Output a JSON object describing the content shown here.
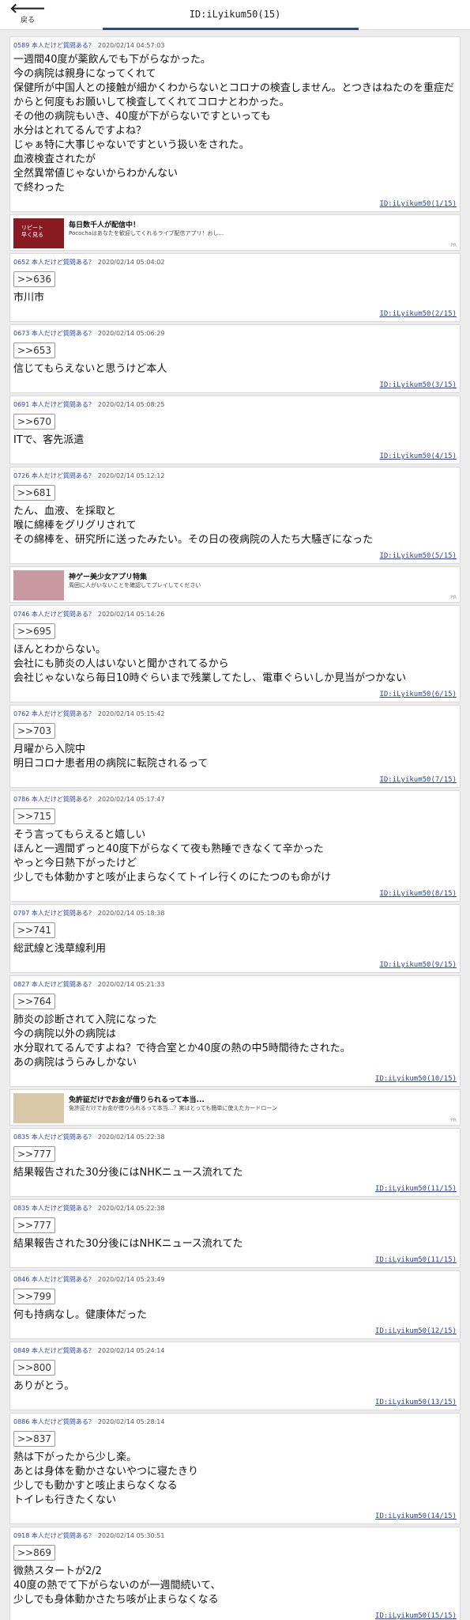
{
  "header": {
    "back_arrow": "🡐",
    "back_label": "戻る",
    "title": "ID:iLyikum50(15)"
  },
  "posts": [
    {
      "meta": "0589 本人だけど質問ある？",
      "ts": "2020/02/14 04:57:03",
      "anchor": "",
      "body": "一週間40度が薬飲んでも下がらなかった。\n今の病院は親身になってくれて\n保健所が中国人との接触が細かくわからないとコロナの検査しません。とつきはねたのを重症だからと何度もお願いして検査してくれてコロナとわかった。\nその他の病院もいき、40度が下がらないですといっても\n水分はとれてるんですよね？\nじゃぁ特に大事じゃないですという扱いをされた。\n血液検査されたが\n全然異常値じゃないからわかんない\nで終わった",
      "uid": "ID:iLyikum50(1/15)"
    },
    {
      "meta": "0652 本人だけど質問ある？",
      "ts": "2020/02/14 05:04:02",
      "anchor": ">>636",
      "body": "市川市",
      "uid": "ID:iLyikum50(2/15)"
    },
    {
      "meta": "0673 本人だけど質問ある？",
      "ts": "2020/02/14 05:06:29",
      "anchor": ">>653",
      "body": "信じてもらえないと思うけど本人",
      "uid": "ID:iLyikum50(3/15)"
    },
    {
      "meta": "0691 本人だけど質問ある？",
      "ts": "2020/02/14 05:08:25",
      "anchor": ">>670",
      "body": "ITで、客先派遣",
      "uid": "ID:iLyikum50(4/15)"
    },
    {
      "meta": "0726 本人だけど質問ある？",
      "ts": "2020/02/14 05:12:12",
      "anchor": ">>681",
      "body": "たん、血液、を採取と\n喉に綿棒をグリグリされて\nその綿棒を、研究所に送ったみたい。その日の夜病院の人たち大騒ぎになった",
      "uid": "ID:iLyikum50(5/15)"
    },
    {
      "meta": "0746 本人だけど質問ある？",
      "ts": "2020/02/14 05:14:26",
      "anchor": ">>695",
      "body": "ほんとわからない。\n会社にも肺炎の人はいないと聞かされてるから\n会社じゃないなら毎日10時ぐらいまで残業してたし、電車ぐらいしか見当がつかない",
      "uid": "ID:iLyikum50(6/15)"
    },
    {
      "meta": "0762 本人だけど質問ある？",
      "ts": "2020/02/14 05:15:42",
      "anchor": ">>703",
      "body": "月曜から入院中\n明日コロナ患者用の病院に転院されるって",
      "uid": "ID:iLyikum50(7/15)"
    },
    {
      "meta": "0786 本人だけど質問ある？",
      "ts": "2020/02/14 05:17:47",
      "anchor": ">>715",
      "body": "そう言ってもらえると嬉しい\nほんと一週間ずっと40度下がらなくて夜も熟睡できなくて辛かった\nやっと今日熱下がったけど\n少しでも体動かすと咳が止まらなくてトイレ行くのにたつのも命がけ",
      "uid": "ID:iLyikum50(8/15)"
    },
    {
      "meta": "0797 本人だけど質問ある？",
      "ts": "2020/02/14 05:18:38",
      "anchor": ">>741",
      "body": "総武線と浅草線利用",
      "uid": "ID:iLyikum50(9/15)"
    },
    {
      "meta": "0827 本人だけど質問ある？",
      "ts": "2020/02/14 05:21:33",
      "anchor": ">>764",
      "body": "肺炎の診断されて入院になった\n今の病院以外の病院は\n水分取れてるんですよね？で待合室とか40度の熱の中5時間待たされた。\nあの病院はうらみしかない",
      "uid": "ID:iLyikum50(10/15)"
    },
    {
      "meta": "0835 本人だけど質問ある？",
      "ts": "2020/02/14 05:22:38",
      "anchor": ">>777",
      "body": "結果報告された30分後にはNHKニュース流れてた",
      "uid": "ID:iLyikum50(11/15)"
    },
    {
      "meta": "0835 本人だけど質問ある？",
      "ts": "2020/02/14 05:22:38",
      "anchor": ">>777",
      "body": "結果報告された30分後にはNHKニュース流れてた",
      "uid": "ID:iLyikum50(11/15)"
    },
    {
      "meta": "0846 本人だけど質問ある？",
      "ts": "2020/02/14 05:23:49",
      "anchor": ">>799",
      "body": "何も持病なし。健康体だった",
      "uid": "ID:iLyikum50(12/15)"
    },
    {
      "meta": "0849 本人だけど質問ある？",
      "ts": "2020/02/14 05:24:14",
      "anchor": ">>800",
      "body": "ありがとう。",
      "uid": "ID:iLyikum50(13/15)"
    },
    {
      "meta": "0886 本人だけど質問ある？",
      "ts": "2020/02/14 05:28:14",
      "anchor": ">>837",
      "body": "熱は下がったから少し楽。\nあとは身体を動かさないやつに寝たきり\n少しでも動かすと咳止まらなくなる\nトイレも行きたくない",
      "uid": "ID:iLyikum50(14/15)"
    },
    {
      "meta": "0918 本人だけど質問ある？",
      "ts": "2020/02/14 05:30:51",
      "anchor": ">>869",
      "body": "微熱スタートが2/2\n40度の熱でて下がらないのが一週間続いて、\n少しでも身体動かさたち咳が止まらなくなる",
      "uid": "ID:iLyikum50(15/15)"
    }
  ],
  "ads": [
    {
      "title": "毎日数千人が配信中！",
      "desc": "Pocochaはあなたを歓迎してくれるライブ配信アプリ！おし...",
      "pr": "PR",
      "thumb_text": "リピート\n早く見る",
      "thumb_color": "#8a1a22"
    },
    {
      "title": "神ゲー美少女アプリ特集",
      "desc": "周囲に人がいないことを確認してプレイしてください",
      "pr": "PR",
      "thumb_text": "",
      "thumb_color": "#c89aa0"
    },
    {
      "title": "免許証だけでお金が借りられるって本当...",
      "desc": "免許証だけでお金が借りられるって本当...？実はとっても簡単に使えたカードローン",
      "pr": "PR",
      "thumb_text": "",
      "thumb_color": "#d8c8a8"
    }
  ]
}
